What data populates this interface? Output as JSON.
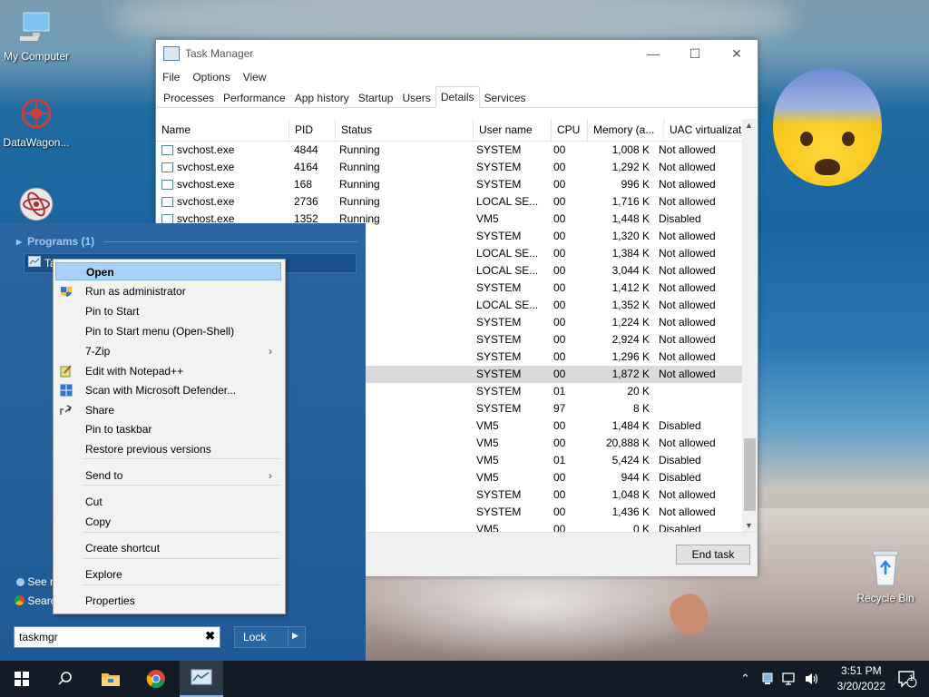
{
  "desktop": {
    "icons": [
      {
        "label": "My Computer",
        "icon": "computer-icon"
      },
      {
        "label": "DataWagon...",
        "icon": "datawagon-icon"
      },
      {
        "label": "",
        "icon": "atom-app-icon"
      },
      {
        "label": "Recycle Bin",
        "icon": "recycle-bin-icon"
      }
    ]
  },
  "task_manager": {
    "title": "Task Manager",
    "menu": [
      "File",
      "Options",
      "View"
    ],
    "tabs": [
      "Processes",
      "Performance",
      "App history",
      "Startup",
      "Users",
      "Details",
      "Services"
    ],
    "active_tab": "Details",
    "columns": [
      "Name",
      "PID",
      "Status",
      "User name",
      "CPU",
      "Memory (a...",
      "UAC virtualizat..."
    ],
    "rows": [
      {
        "name": "svchost.exe",
        "pid": "4844",
        "status": "Running",
        "user": "SYSTEM",
        "cpu": "00",
        "mem": "1,008 K",
        "uac": "Not allowed"
      },
      {
        "name": "svchost.exe",
        "pid": "4164",
        "status": "Running",
        "user": "SYSTEM",
        "cpu": "00",
        "mem": "1,292 K",
        "uac": "Not allowed"
      },
      {
        "name": "svchost.exe",
        "pid": "168",
        "status": "Running",
        "user": "SYSTEM",
        "cpu": "00",
        "mem": "996 K",
        "uac": "Not allowed"
      },
      {
        "name": "svchost.exe",
        "pid": "2736",
        "status": "Running",
        "user": "LOCAL SE...",
        "cpu": "00",
        "mem": "1,716 K",
        "uac": "Not allowed"
      },
      {
        "name": "svchost.exe",
        "pid": "1352",
        "status": "Running",
        "user": "VM5",
        "cpu": "00",
        "mem": "1,448 K",
        "uac": "Disabled"
      },
      {
        "name": "",
        "pid": "",
        "status": "ng",
        "user": "SYSTEM",
        "cpu": "00",
        "mem": "1,320 K",
        "uac": "Not allowed"
      },
      {
        "name": "",
        "pid": "",
        "status": "ng",
        "user": "LOCAL SE...",
        "cpu": "00",
        "mem": "1,384 K",
        "uac": "Not allowed"
      },
      {
        "name": "",
        "pid": "",
        "status": "ng",
        "user": "LOCAL SE...",
        "cpu": "00",
        "mem": "3,044 K",
        "uac": "Not allowed"
      },
      {
        "name": "",
        "pid": "",
        "status": "ng",
        "user": "SYSTEM",
        "cpu": "00",
        "mem": "1,412 K",
        "uac": "Not allowed"
      },
      {
        "name": "",
        "pid": "",
        "status": "ng",
        "user": "LOCAL SE...",
        "cpu": "00",
        "mem": "1,352 K",
        "uac": "Not allowed"
      },
      {
        "name": "",
        "pid": "",
        "status": "ng",
        "user": "SYSTEM",
        "cpu": "00",
        "mem": "1,224 K",
        "uac": "Not allowed"
      },
      {
        "name": "",
        "pid": "",
        "status": "ng",
        "user": "SYSTEM",
        "cpu": "00",
        "mem": "2,924 K",
        "uac": "Not allowed"
      },
      {
        "name": "",
        "pid": "",
        "status": "ng",
        "user": "SYSTEM",
        "cpu": "00",
        "mem": "1,296 K",
        "uac": "Not allowed"
      },
      {
        "name": "",
        "pid": "",
        "status": "ng",
        "user": "SYSTEM",
        "cpu": "00",
        "mem": "1,872 K",
        "uac": "Not allowed",
        "selected": true
      },
      {
        "name": "",
        "pid": "",
        "status": "ng",
        "user": "SYSTEM",
        "cpu": "01",
        "mem": "20 K",
        "uac": ""
      },
      {
        "name": "",
        "pid": "",
        "status": "ng",
        "user": "SYSTEM",
        "cpu": "97",
        "mem": "8 K",
        "uac": ""
      },
      {
        "name": "",
        "pid": "",
        "status": "ng",
        "user": "VM5",
        "cpu": "00",
        "mem": "1,484 K",
        "uac": "Disabled"
      },
      {
        "name": "",
        "pid": "",
        "status": "ng",
        "user": "VM5",
        "cpu": "00",
        "mem": "20,888 K",
        "uac": "Not allowed"
      },
      {
        "name": "",
        "pid": "",
        "status": "ng",
        "user": "VM5",
        "cpu": "01",
        "mem": "5,424 K",
        "uac": "Disabled"
      },
      {
        "name": "",
        "pid": "",
        "status": "ng",
        "user": "VM5",
        "cpu": "00",
        "mem": "944 K",
        "uac": "Disabled"
      },
      {
        "name": "",
        "pid": "",
        "status": "ng",
        "user": "SYSTEM",
        "cpu": "00",
        "mem": "1,048 K",
        "uac": "Not allowed"
      },
      {
        "name": "",
        "pid": "",
        "status": "ng",
        "user": "SYSTEM",
        "cpu": "00",
        "mem": "1,436 K",
        "uac": "Not allowed"
      },
      {
        "name": "",
        "pid": "",
        "status": "nded",
        "user": "VM5",
        "cpu": "00",
        "mem": "0 K",
        "uac": "Disabled"
      }
    ],
    "end_task_label": "End task"
  },
  "start_menu": {
    "programs_header": "Programs (1)",
    "selected_program": "Tas",
    "see_more": "See r",
    "search_web": "Searc",
    "search_value": "taskmgr",
    "lock_label": "Lock"
  },
  "context_menu": {
    "items": [
      {
        "label": "Open",
        "icon": "",
        "highlighted": true
      },
      {
        "label": "Run as administrator",
        "icon": "shield-icon"
      },
      {
        "label": "Pin to Start",
        "icon": ""
      },
      {
        "label": "Pin to Start menu (Open-Shell)",
        "icon": ""
      },
      {
        "label": "7-Zip",
        "icon": "",
        "submenu": true
      },
      {
        "label": "Edit with Notepad++",
        "icon": "notepadpp-icon"
      },
      {
        "label": "Scan with Microsoft Defender...",
        "icon": "defender-icon"
      },
      {
        "label": "Share",
        "icon": "share-icon"
      },
      {
        "label": "Pin to taskbar",
        "icon": ""
      },
      {
        "label": "Restore previous versions",
        "icon": ""
      },
      {
        "label": "Send to",
        "icon": "",
        "submenu": true
      },
      {
        "label": "Cut",
        "icon": ""
      },
      {
        "label": "Copy",
        "icon": ""
      },
      {
        "label": "Create shortcut",
        "icon": ""
      },
      {
        "label": "Explore",
        "icon": ""
      },
      {
        "label": "Properties",
        "icon": ""
      }
    ]
  },
  "taskbar": {
    "time": "3:51 PM",
    "date": "3/20/2022",
    "notification_count": "1",
    "accent": "#8ab4e8"
  }
}
